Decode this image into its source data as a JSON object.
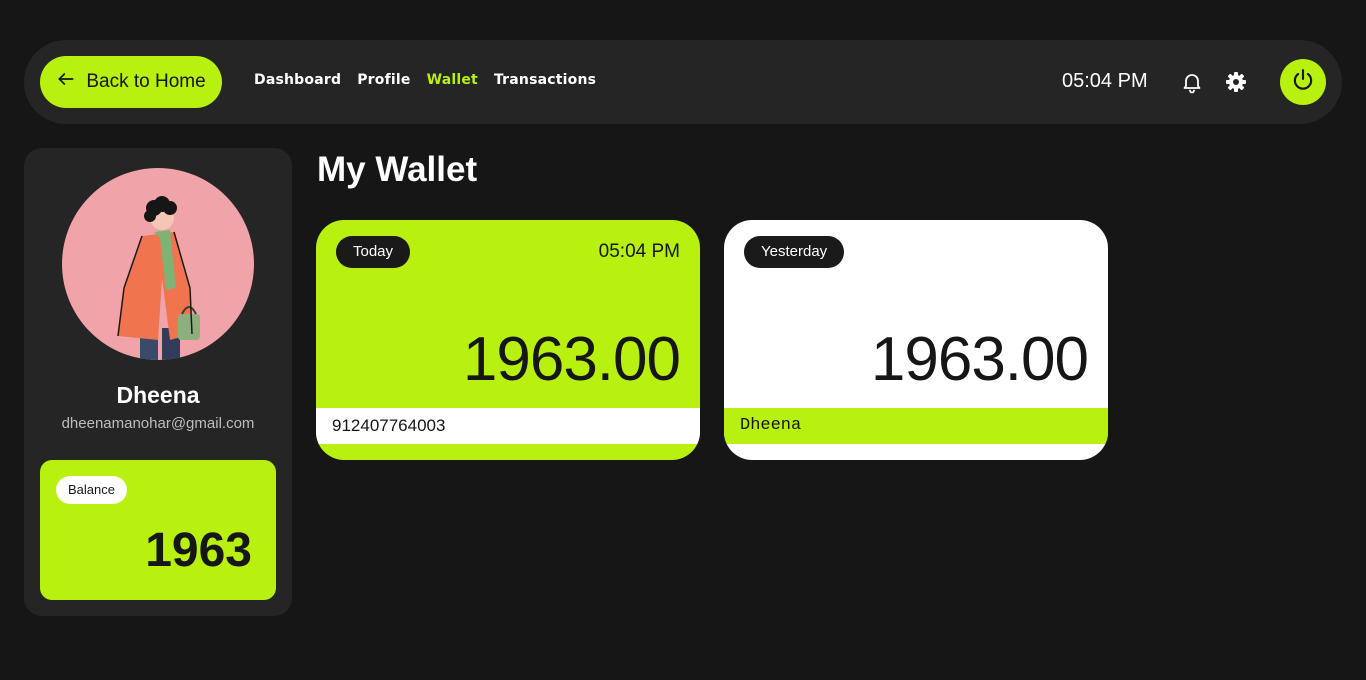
{
  "topbar": {
    "back_label": "Back to Home",
    "nav": [
      {
        "label": "Dashboard",
        "active": false
      },
      {
        "label": "Profile",
        "active": false
      },
      {
        "label": "Wallet",
        "active": true
      },
      {
        "label": "Transactions",
        "active": false
      }
    ],
    "clock": "05:04 PM",
    "icons": [
      "arrow-left-icon",
      "bell-icon",
      "gear-icon",
      "power-icon"
    ]
  },
  "profile": {
    "name": "Dheena",
    "email": "dheenamanohar@gmail.com",
    "balance_label": "Balance",
    "balance_value": "1963"
  },
  "main": {
    "title": "My Wallet",
    "cards": [
      {
        "tag": "Today",
        "time": "05:04 PM",
        "amount": "1963.00",
        "footer": "912407764003"
      },
      {
        "tag": "Yesterday",
        "amount": "1963.00",
        "footer": "Dheena"
      }
    ]
  },
  "colors": {
    "background": "#161616",
    "panel": "#252525",
    "accent": "#b8f00f",
    "avatar_bg": "#f0a3a8"
  }
}
